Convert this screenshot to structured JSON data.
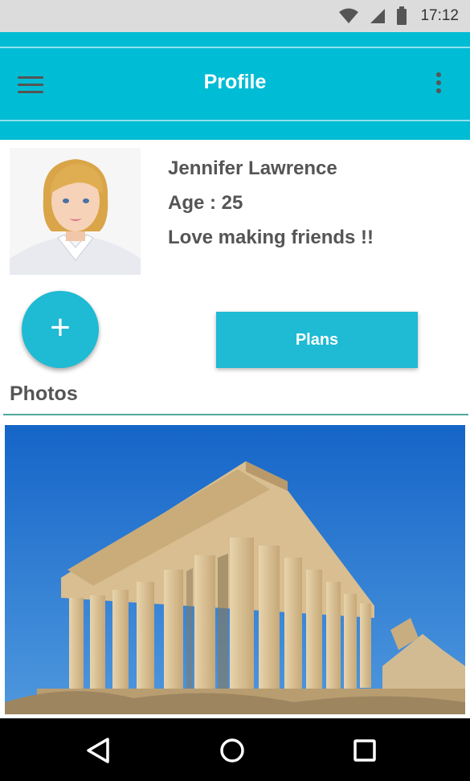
{
  "status_bar": {
    "time": "17:12",
    "icons": [
      "wifi-icon",
      "cell-signal-icon",
      "battery-icon"
    ]
  },
  "app_bar": {
    "title": "Profile",
    "left_icon": "menu-icon",
    "right_icon": "more-vert-icon"
  },
  "profile": {
    "name": "Jennifer Lawrence",
    "age": "Age : 25",
    "bio": "Love making friends !!",
    "avatar": "avatar-photo"
  },
  "actions": {
    "fab_icon": "+",
    "plans_label": "Plans"
  },
  "photos": {
    "heading": "Photos",
    "items": [
      "parthenon-photo"
    ]
  },
  "nav_bar": {
    "buttons": [
      "back-icon",
      "home-icon",
      "recents-icon"
    ]
  },
  "colors": {
    "accent": "#00bcd4",
    "button": "#1fbad3",
    "divider": "#4fa89a",
    "text": "#555555"
  }
}
